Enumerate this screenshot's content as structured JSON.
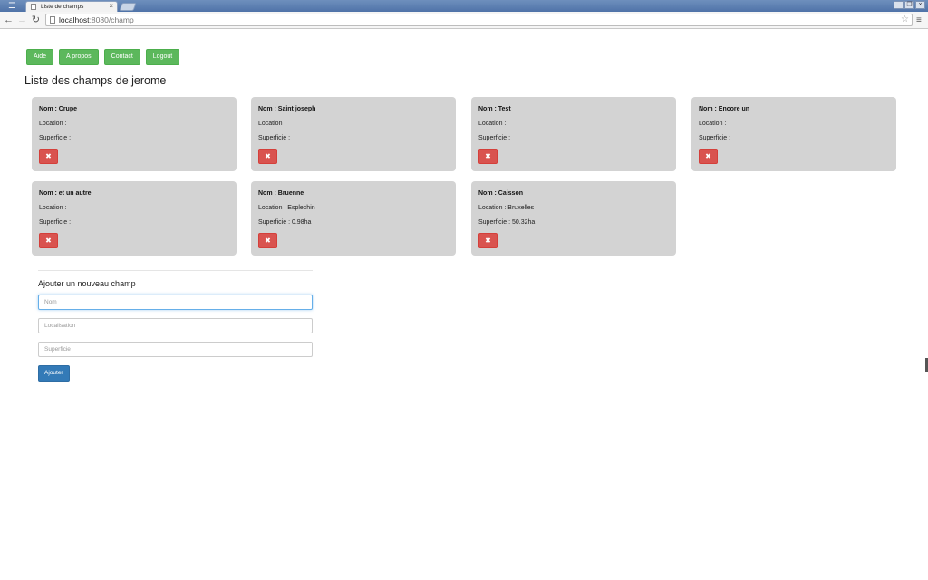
{
  "browser": {
    "tab_title": "Liste de champs",
    "url_host": "localhost",
    "url_port": ":8080",
    "url_path": "/champ"
  },
  "nav": {
    "items": [
      {
        "label": "Aide"
      },
      {
        "label": "A propos"
      },
      {
        "label": "Contact"
      },
      {
        "label": "Logout"
      }
    ]
  },
  "page_title": "Liste des champs de jerome",
  "fields": [
    {
      "name": "Nom : Crupe",
      "location": "Location :",
      "superficie": "Superficie :"
    },
    {
      "name": "Nom : Saint joseph",
      "location": "Location :",
      "superficie": "Superficie :"
    },
    {
      "name": "Nom : Test",
      "location": "Location :",
      "superficie": "Superficie :"
    },
    {
      "name": "Nom : Encore un",
      "location": "Location :",
      "superficie": "Superficie :"
    },
    {
      "name": "Nom : et un autre",
      "location": "Location :",
      "superficie": "Superficie :"
    },
    {
      "name": "Nom : Bruenne",
      "location": "Location : Esplechin",
      "superficie": "Superficie : 0.98ha"
    },
    {
      "name": "Nom : Caisson",
      "location": "Location : Bruxelles",
      "superficie": "Superficie : 50.32ha"
    }
  ],
  "delete_icon": "✖",
  "form": {
    "title": "Ajouter un nouveau champ",
    "nom_placeholder": "Nom",
    "localisation_placeholder": "Localisation",
    "superficie_placeholder": "Superficie",
    "submit_label": "Ajouter"
  },
  "colors": {
    "nav_button": "#5cb85c",
    "card_bg": "#d3d3d3",
    "delete_button": "#d9534f",
    "submit_button": "#337ab7"
  }
}
